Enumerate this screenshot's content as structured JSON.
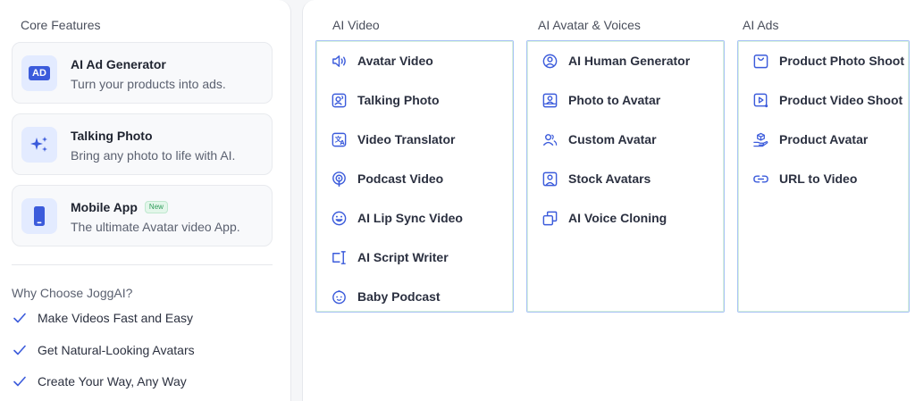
{
  "core": {
    "title": "Core Features",
    "cards": [
      {
        "icon": "ad-icon",
        "icon_text": "AD",
        "title": "AI Ad Generator",
        "subtitle": "Turn your products into ads."
      },
      {
        "icon": "sparkles-icon",
        "title": "Talking Photo",
        "subtitle": "Bring any photo to life with AI."
      },
      {
        "icon": "phone-icon",
        "title": "Mobile App",
        "badge": "New",
        "subtitle": "The ultimate Avatar video App."
      }
    ]
  },
  "why": {
    "title": "Why Choose JoggAI?",
    "items": [
      "Make Videos Fast and Easy",
      "Get Natural-Looking Avatars",
      "Create Your Way, Any Way"
    ]
  },
  "columns": [
    {
      "title": "AI Video",
      "items": [
        {
          "label": "Avatar Video",
          "icon": "speaker-icon"
        },
        {
          "label": "Talking Photo",
          "icon": "portrait-sound-icon"
        },
        {
          "label": "Video Translator",
          "icon": "translate-icon"
        },
        {
          "label": "Podcast Video",
          "icon": "podcast-icon"
        },
        {
          "label": "AI Lip Sync Video",
          "icon": "smile-icon"
        },
        {
          "label": "AI Script Writer",
          "icon": "text-cursor-icon"
        },
        {
          "label": "Baby Podcast",
          "icon": "baby-icon"
        }
      ]
    },
    {
      "title": "AI Avatar & Voices",
      "items": [
        {
          "label": "AI Human Generator",
          "icon": "user-circle-icon"
        },
        {
          "label": "Photo to Avatar",
          "icon": "user-square-icon"
        },
        {
          "label": "Custom Avatar",
          "icon": "users-icon"
        },
        {
          "label": "Stock Avatars",
          "icon": "user-frame-icon"
        },
        {
          "label": "AI Voice Cloning",
          "icon": "copy-icon"
        }
      ]
    },
    {
      "title": "AI Ads",
      "items": [
        {
          "label": "Product Photo Shoot",
          "icon": "bag-icon"
        },
        {
          "label": "Product Video Shoot",
          "icon": "video-play-icon"
        },
        {
          "label": "Product Avatar",
          "icon": "hand-box-icon"
        },
        {
          "label": "URL to Video",
          "icon": "link-icon"
        }
      ]
    }
  ],
  "colors": {
    "accent": "#3b5bdb",
    "icon_bg": "#e3ebff",
    "badge_green": "#2f9b5a"
  }
}
